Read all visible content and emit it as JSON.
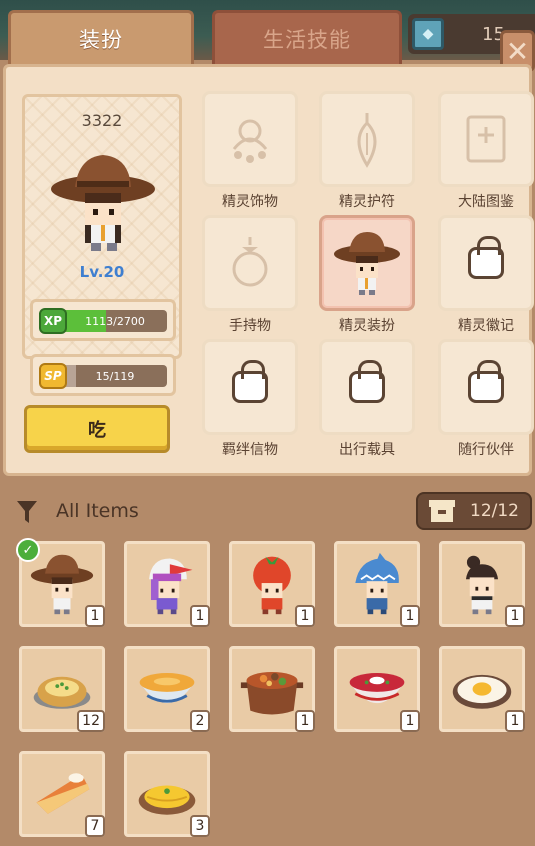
{
  "tabs": {
    "active": "装扮",
    "inactive": "生活技能"
  },
  "currency": {
    "amount": "15",
    "icon": "gem-icon"
  },
  "character": {
    "id": "3322",
    "level": "Lv.20",
    "xp": {
      "badge": "XP",
      "text": "1113/2700",
      "progress": 0.412
    },
    "sp": {
      "badge": "SP",
      "text": "15/119",
      "progress": 0.126
    },
    "eat_label": "吃"
  },
  "slots": [
    {
      "label": "精灵饰物",
      "icon": "accessory-icon",
      "state": "empty"
    },
    {
      "label": "精灵护符",
      "icon": "amulet-icon",
      "state": "empty"
    },
    {
      "label": "大陆图鉴",
      "icon": "book-icon",
      "state": "empty"
    },
    {
      "label": "手持物",
      "icon": "orb-icon",
      "state": "empty"
    },
    {
      "label": "精灵装扮",
      "icon": "cowboy-hat-costume-icon",
      "state": "selected"
    },
    {
      "label": "精灵徽记",
      "icon": "lock-icon",
      "state": "locked"
    },
    {
      "label": "羁绊信物",
      "icon": "lock-icon",
      "state": "locked"
    },
    {
      "label": "出行载具",
      "icon": "lock-icon",
      "state": "locked"
    },
    {
      "label": "随行伙伴",
      "icon": "lock-icon",
      "state": "locked"
    }
  ],
  "inventory": {
    "filter_label": "All Items",
    "capacity": "12/12",
    "items": [
      {
        "icon": "cowboy-hat-costume-icon",
        "qty": "1",
        "equipped": true
      },
      {
        "icon": "bird-hat-costume-icon",
        "qty": "1"
      },
      {
        "icon": "tomato-hat-costume-icon",
        "qty": "1"
      },
      {
        "icon": "shark-hat-costume-icon",
        "qty": "1"
      },
      {
        "icon": "bun-hair-costume-icon",
        "qty": "1"
      },
      {
        "icon": "baked-potato-icon",
        "qty": "12"
      },
      {
        "icon": "pumpkin-soup-icon",
        "qty": "2"
      },
      {
        "icon": "stew-pot-icon",
        "qty": "1"
      },
      {
        "icon": "borscht-bowl-icon",
        "qty": "1"
      },
      {
        "icon": "fried-egg-icon",
        "qty": "1"
      },
      {
        "icon": "pie-slice-icon",
        "qty": "7"
      },
      {
        "icon": "omelette-icon",
        "qty": "3"
      }
    ]
  }
}
